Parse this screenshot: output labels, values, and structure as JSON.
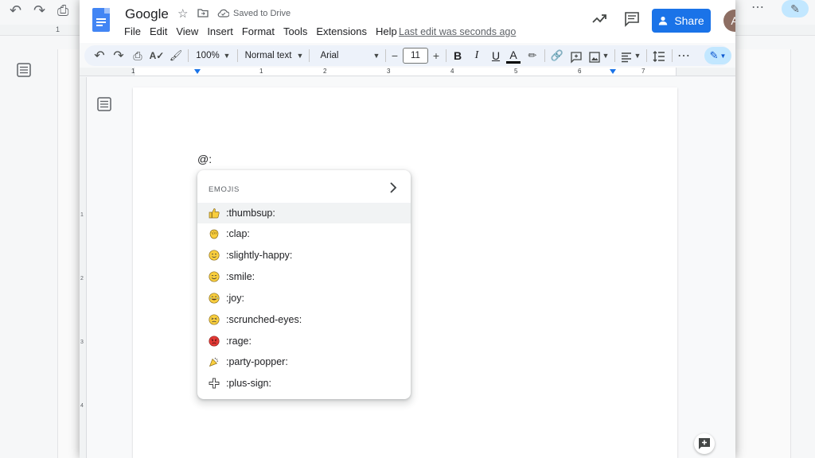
{
  "background": {
    "ruler_number": "1"
  },
  "header": {
    "title": "Google",
    "saved_status": "Saved to Drive",
    "last_edit": "Last edit was seconds ago",
    "share_label": "Share",
    "avatar_initial": "A"
  },
  "menu": [
    "File",
    "Edit",
    "View",
    "Insert",
    "Format",
    "Tools",
    "Extensions",
    "Help"
  ],
  "toolbar": {
    "zoom": "100%",
    "style": "Normal text",
    "font": "Arial",
    "font_size": "11",
    "minus": "−",
    "plus": "+",
    "bold": "B",
    "italic": "I",
    "underline": "U",
    "text_color": "A",
    "more": "⋯"
  },
  "ruler": {
    "numbers": [
      "1",
      "1",
      "2",
      "3",
      "4",
      "5",
      "6",
      "7"
    ],
    "vertical_numbers": [
      "1",
      "2",
      "3",
      "4"
    ]
  },
  "document": {
    "typed_text": "@:"
  },
  "emoji_popup": {
    "heading": "EMOJIS",
    "items": [
      {
        "label": ":thumbsup:",
        "icon": "thumbsup-icon",
        "selected": true
      },
      {
        "label": ":clap:",
        "icon": "clap-icon"
      },
      {
        "label": ":slightly-happy:",
        "icon": "slightly-happy-icon"
      },
      {
        "label": ":smile:",
        "icon": "smile-icon"
      },
      {
        "label": ":joy:",
        "icon": "joy-icon"
      },
      {
        "label": ":scrunched-eyes:",
        "icon": "scrunched-eyes-icon"
      },
      {
        "label": ":rage:",
        "icon": "rage-icon"
      },
      {
        "label": ":party-popper:",
        "icon": "party-popper-icon"
      },
      {
        "label": ":plus-sign:",
        "icon": "plus-sign-icon"
      }
    ]
  },
  "colors": {
    "accent": "#1a73e8",
    "toolbar_bg": "#edf2fa",
    "emoji_yellow": "#f9ce3e",
    "rage_red": "#e53935"
  }
}
